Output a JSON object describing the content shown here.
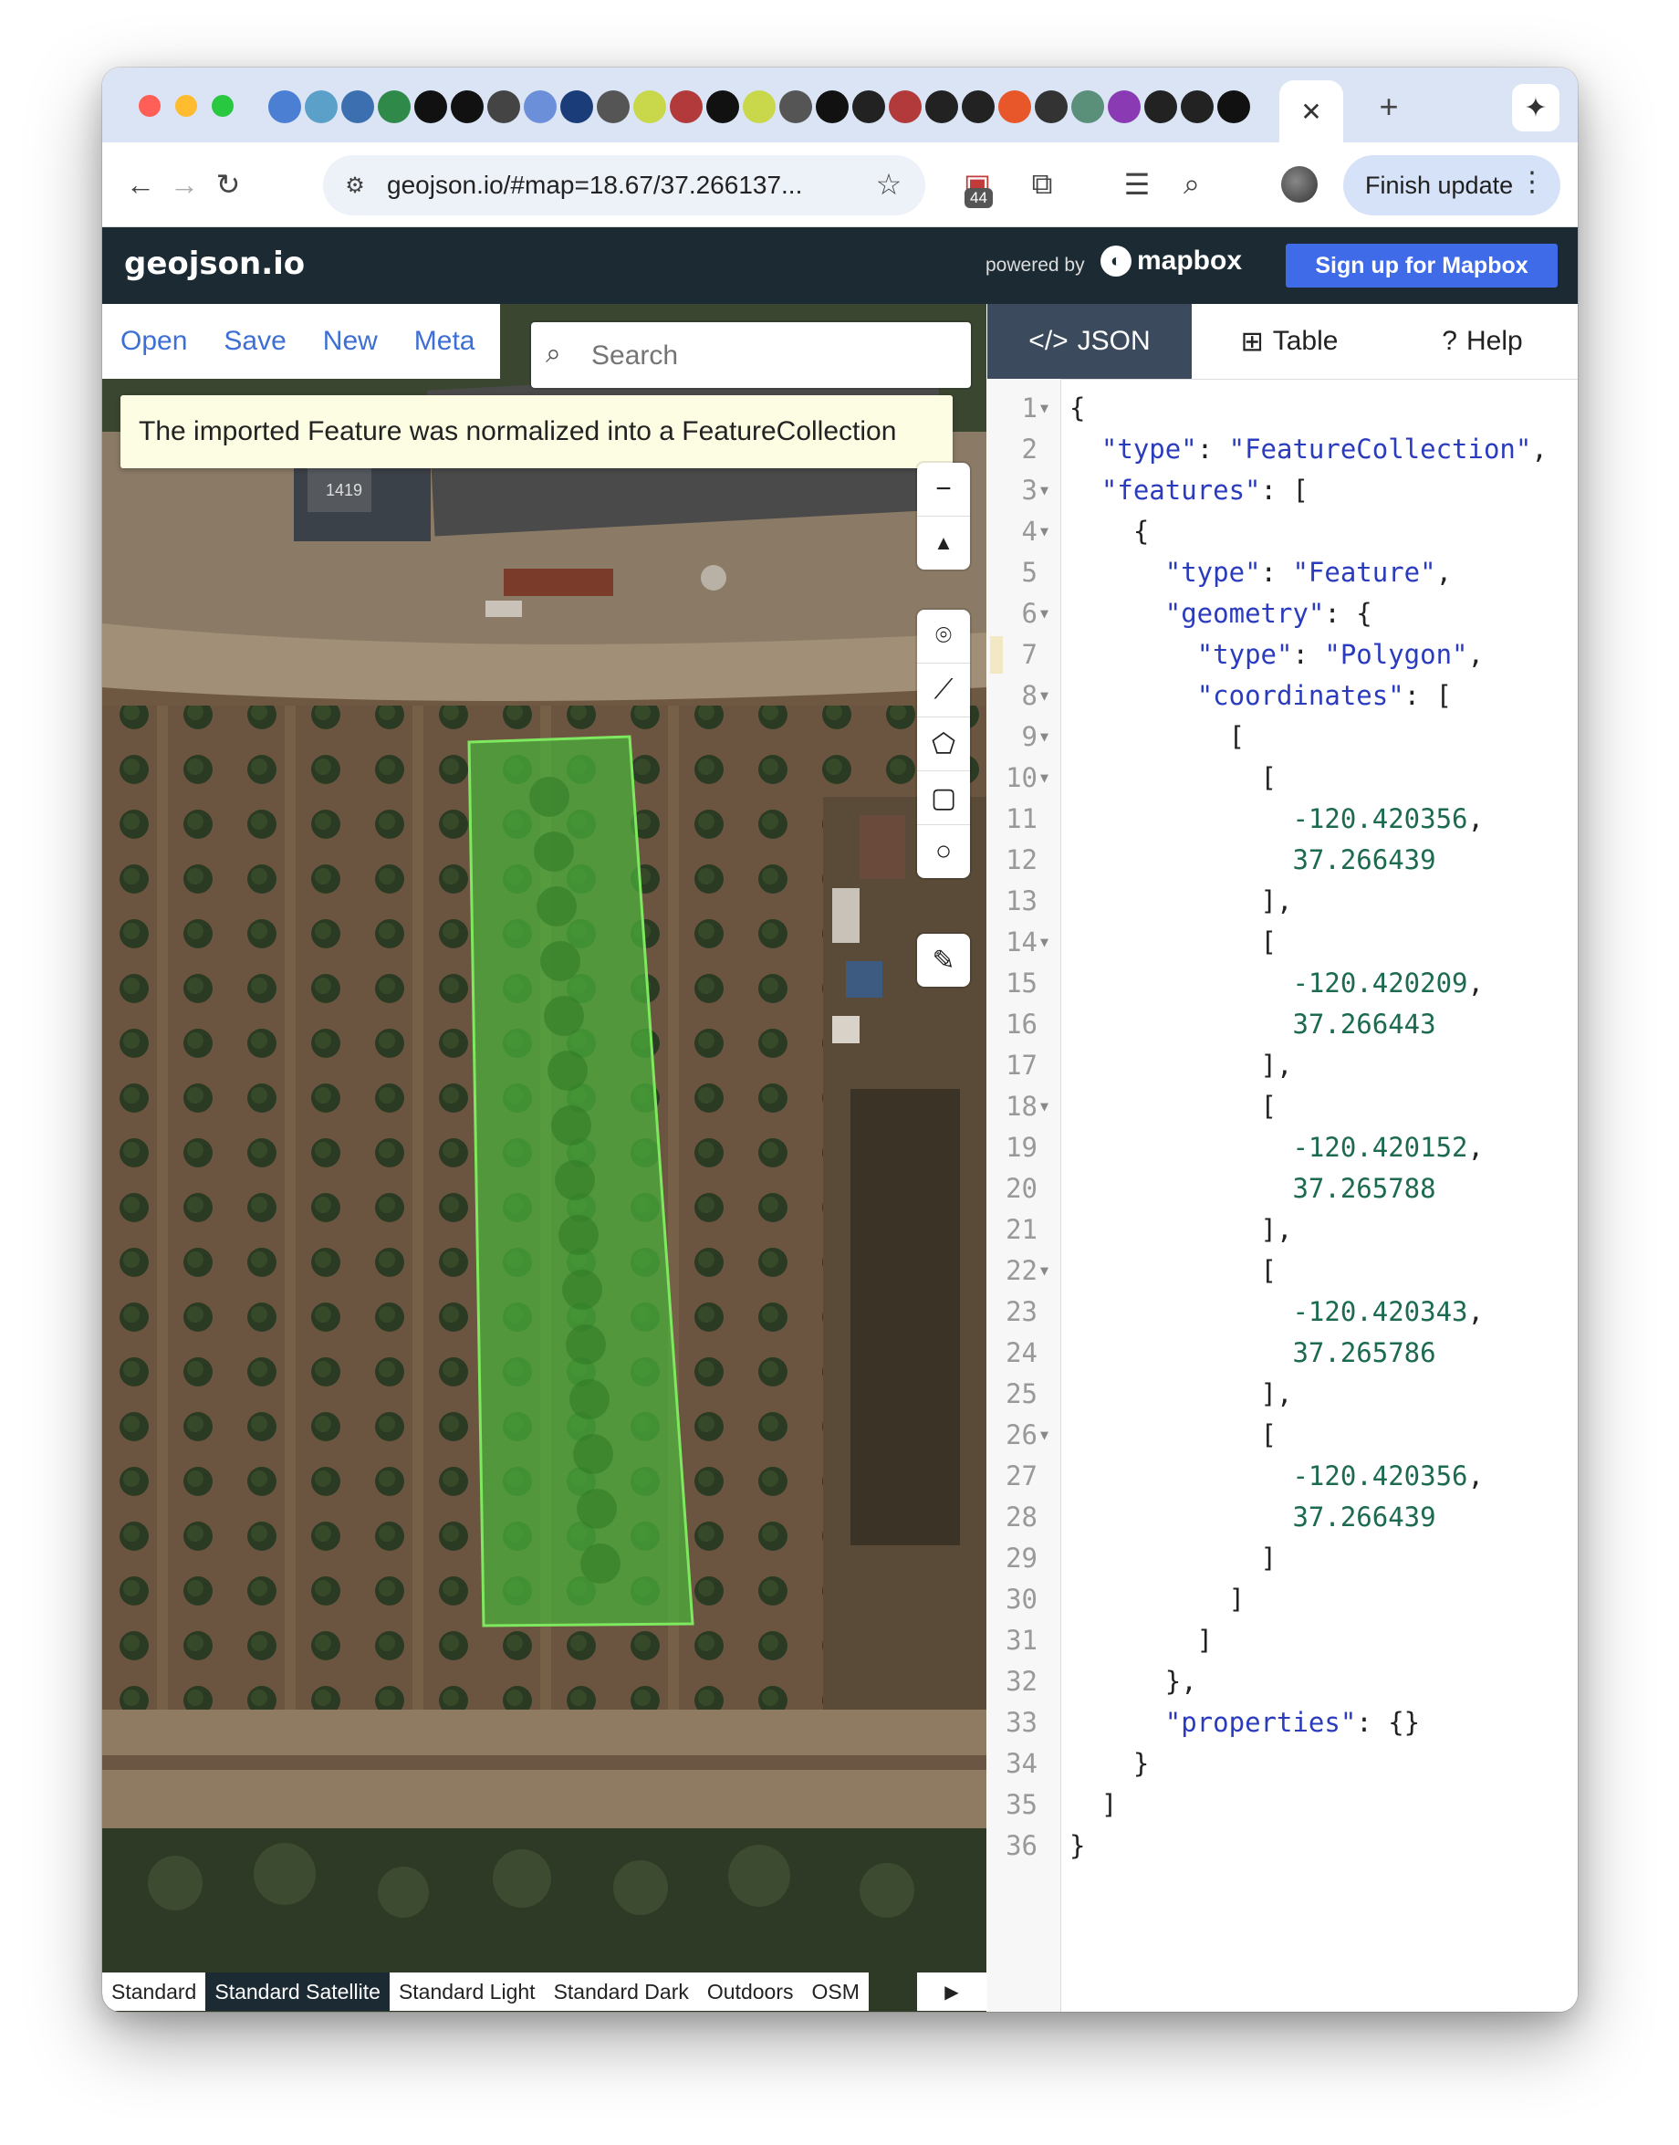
{
  "browser": {
    "url": "geojson.io/#map=18.67/37.266137...",
    "extension_badge": "44",
    "finish_update_label": "Finish update",
    "new_tab_label": "+",
    "close_tab_label": "✕"
  },
  "app": {
    "logo": "geojson.io",
    "powered_by": "powered by",
    "mapbox_wordmark": "mapbox",
    "signup_label": "Sign up for Mapbox"
  },
  "menu": {
    "items": [
      "Open",
      "Save",
      "New",
      "Meta"
    ]
  },
  "search": {
    "placeholder": "Search"
  },
  "notice": "The imported Feature was normalized into a FeatureCollection",
  "map": {
    "house_number": "1419",
    "styles": [
      "Standard",
      "Standard Satellite",
      "Standard Light",
      "Standard Dark",
      "Outdoors",
      "OSM"
    ],
    "active_style": "Standard Satellite",
    "attribution_logo": "mapbox",
    "polygon_color": "#7ee85f"
  },
  "panel": {
    "tabs": [
      {
        "label": "JSON",
        "icon": "code-icon"
      },
      {
        "label": "Table",
        "icon": "table-icon"
      },
      {
        "label": "Help",
        "icon": "question-icon"
      }
    ],
    "active_tab": "JSON",
    "active_line": 7,
    "lines": [
      {
        "n": "1",
        "fold": true,
        "text": "{"
      },
      {
        "n": "2",
        "fold": false,
        "text": "  \"type\": \"FeatureCollection\","
      },
      {
        "n": "3",
        "fold": true,
        "text": "  \"features\": ["
      },
      {
        "n": "4",
        "fold": true,
        "text": "    {"
      },
      {
        "n": "5",
        "fold": false,
        "text": "      \"type\": \"Feature\","
      },
      {
        "n": "6",
        "fold": true,
        "text": "      \"geometry\": {"
      },
      {
        "n": "7",
        "fold": false,
        "text": "        \"type\": \"Polygon\","
      },
      {
        "n": "8",
        "fold": true,
        "text": "        \"coordinates\": ["
      },
      {
        "n": "9",
        "fold": true,
        "text": "          ["
      },
      {
        "n": "10",
        "fold": true,
        "text": "            ["
      },
      {
        "n": "11",
        "fold": false,
        "text": "              -120.420356,"
      },
      {
        "n": "12",
        "fold": false,
        "text": "              37.266439"
      },
      {
        "n": "13",
        "fold": false,
        "text": "            ],"
      },
      {
        "n": "14",
        "fold": true,
        "text": "            ["
      },
      {
        "n": "15",
        "fold": false,
        "text": "              -120.420209,"
      },
      {
        "n": "16",
        "fold": false,
        "text": "              37.266443"
      },
      {
        "n": "17",
        "fold": false,
        "text": "            ],"
      },
      {
        "n": "18",
        "fold": true,
        "text": "            ["
      },
      {
        "n": "19",
        "fold": false,
        "text": "              -120.420152,"
      },
      {
        "n": "20",
        "fold": false,
        "text": "              37.265788"
      },
      {
        "n": "21",
        "fold": false,
        "text": "            ],"
      },
      {
        "n": "22",
        "fold": true,
        "text": "            ["
      },
      {
        "n": "23",
        "fold": false,
        "text": "              -120.420343,"
      },
      {
        "n": "24",
        "fold": false,
        "text": "              37.265786"
      },
      {
        "n": "25",
        "fold": false,
        "text": "            ],"
      },
      {
        "n": "26",
        "fold": true,
        "text": "            ["
      },
      {
        "n": "27",
        "fold": false,
        "text": "              -120.420356,"
      },
      {
        "n": "28",
        "fold": false,
        "text": "              37.266439"
      },
      {
        "n": "29",
        "fold": false,
        "text": "            ]"
      },
      {
        "n": "30",
        "fold": false,
        "text": "          ]"
      },
      {
        "n": "31",
        "fold": false,
        "text": "        ]"
      },
      {
        "n": "32",
        "fold": false,
        "text": "      },"
      },
      {
        "n": "33",
        "fold": false,
        "text": "      \"properties\": {}"
      },
      {
        "n": "34",
        "fold": false,
        "text": "    }"
      },
      {
        "n": "35",
        "fold": false,
        "text": "  ]"
      },
      {
        "n": "36",
        "fold": false,
        "text": "}"
      }
    ]
  }
}
